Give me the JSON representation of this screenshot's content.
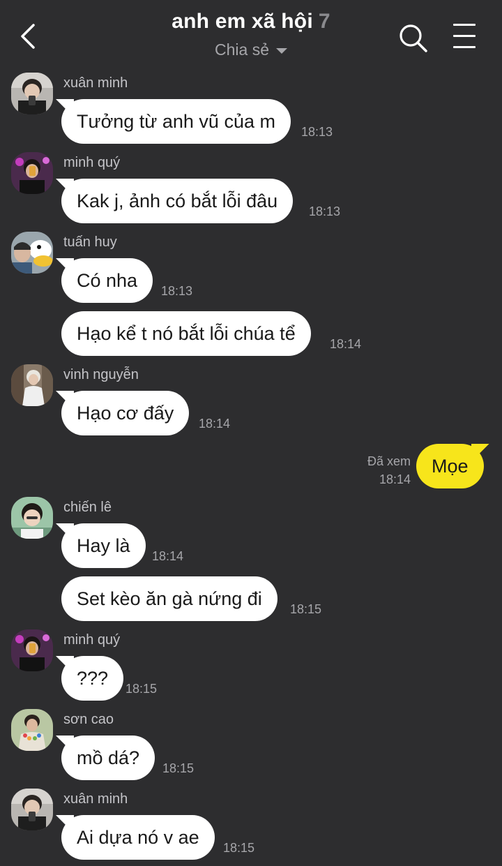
{
  "header": {
    "title": "anh em xã hội",
    "member_count": "7",
    "subtitle": "Chia sẻ"
  },
  "messages": [
    {
      "sender": "xuân minh",
      "text": "Tưởng từ anh vũ của m",
      "time": "18:13"
    },
    {
      "sender": "minh quý",
      "text": "Kak j, ảnh có bắt lỗi đâu",
      "time": "18:13"
    },
    {
      "sender": "tuấn huy",
      "text": "Có nha",
      "time": "18:13"
    },
    {
      "sender": "",
      "text": "Hạo kể t nó bắt lỗi chúa tể",
      "time": "18:14"
    },
    {
      "sender": "vinh nguyễn",
      "text": "Hạo cơ đấy",
      "time": "18:14"
    },
    {
      "sender": "",
      "text": "Mọe",
      "time": "18:14",
      "status": "Đã xem"
    },
    {
      "sender": "chiến lê",
      "text": "Hay là",
      "time": "18:14"
    },
    {
      "sender": "",
      "text": "Set kèo ăn gà nứng đi",
      "time": "18:15"
    },
    {
      "sender": "minh quý",
      "text": "???",
      "time": "18:15"
    },
    {
      "sender": "sơn cao",
      "text": "mồ dá?",
      "time": "18:15"
    },
    {
      "sender": "xuân minh",
      "text": "Ai dựa nó v ae",
      "time": "18:15"
    }
  ],
  "colors": {
    "background": "#2d2d2f",
    "incoming_bubble": "#ffffff",
    "outgoing_bubble": "#f7e51b",
    "muted_text": "#a6a6aa"
  }
}
